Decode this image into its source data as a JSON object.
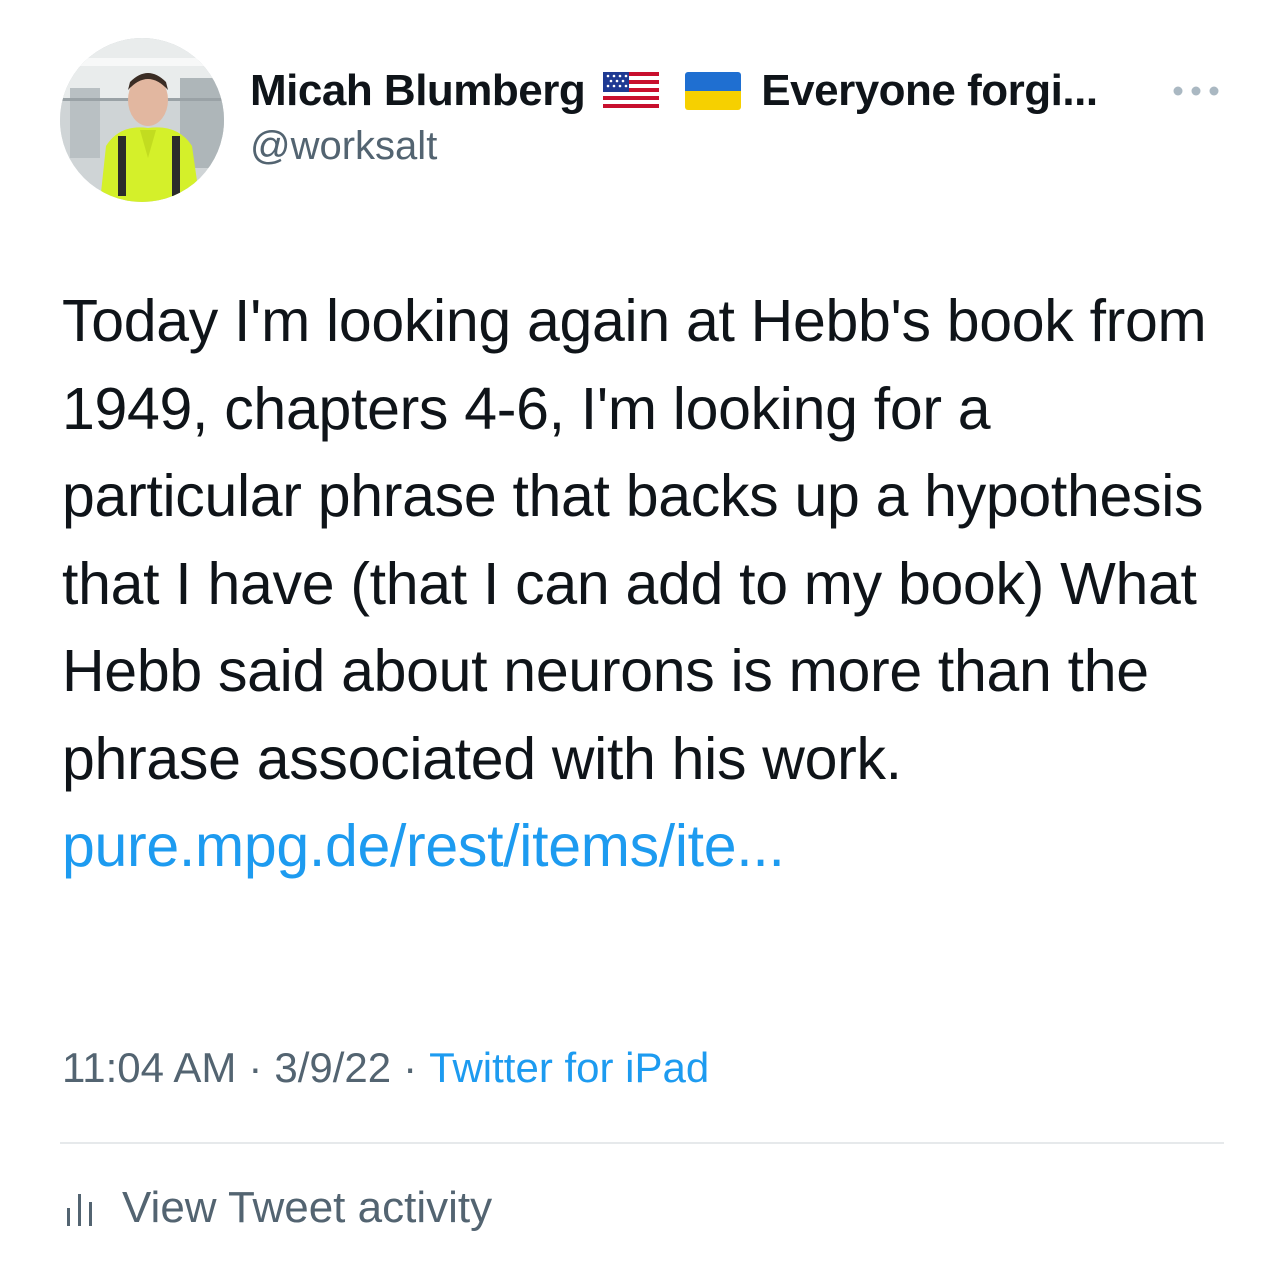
{
  "author": {
    "display_name": "Micah Blumberg",
    "flags": [
      "us-flag-icon",
      "ukraine-flag-icon"
    ],
    "bio_snippet": "Everyone forgi...",
    "handle": "@worksalt"
  },
  "tweet": {
    "text": "Today I'm looking again at Hebb's book from 1949, chapters 4-6, I'm looking for a particular phrase that backs up a hypothesis that I have (that I can add to my book) What Hebb said about neurons is more than the phrase associated with his work. ",
    "link_text": "pure.mpg.de/rest/items/ite..."
  },
  "meta": {
    "time": "11:04 AM",
    "separator": "·",
    "date": "3/9/22",
    "source": "Twitter for iPad"
  },
  "activity": {
    "label": "View Tweet activity"
  },
  "colors": {
    "text": "#0f1419",
    "secondary": "#536471",
    "link": "#1d9bf0",
    "divider": "#e6e9eb",
    "jacket": "#d4f02a"
  }
}
